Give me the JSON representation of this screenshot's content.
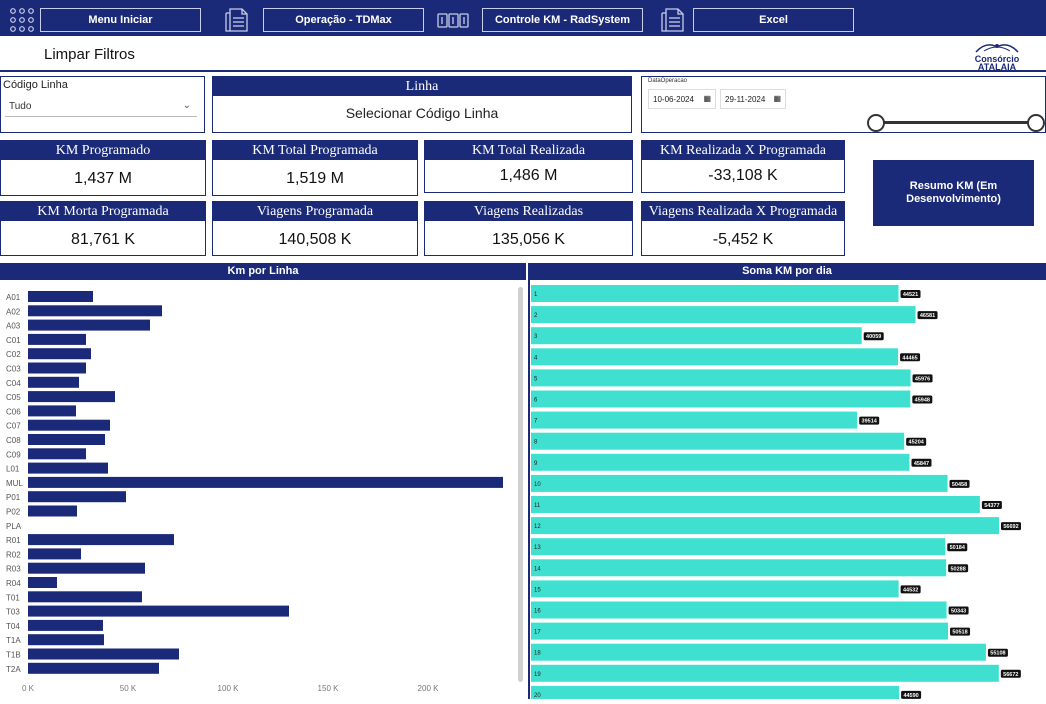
{
  "nav": {
    "menu_label": "Menu Iniciar",
    "operacao_label": "Operação - TDMax",
    "controle_label": "Controle KM - RadSystem",
    "excel_label": "Excel"
  },
  "filter_bar": {
    "limpar_label": "Limpar Filtros",
    "logo_line1": "Consórcio",
    "logo_line2": "ATALAIA"
  },
  "slicer_codigo": {
    "title": "Código Linha",
    "value": "Tudo"
  },
  "slicer_linha": {
    "title": "Linha",
    "value": "Selecionar Código Linha"
  },
  "slicer_data": {
    "title": "DataOperacao",
    "start": "10-06-2024",
    "end": "29-11-2024"
  },
  "kpis": [
    {
      "title": "KM Programado",
      "value": "1,437 M"
    },
    {
      "title": "KM Total Programada",
      "value": "1,519 M"
    },
    {
      "title": "KM Total Realizada",
      "value": "1,486 M"
    },
    {
      "title": "KM Realizada X Programada",
      "value": "-33,108 K"
    },
    {
      "title": "KM Morta Programada",
      "value": "81,761 K"
    },
    {
      "title": "Viagens Programada",
      "value": "140,508 K"
    },
    {
      "title": "Viagens Realizadas",
      "value": "135,056 K"
    },
    {
      "title": "Viagens Realizada X Programada",
      "value": "-5,452 K"
    }
  ],
  "resumo_button": "Resumo KM (Em Desenvolvimento)",
  "colors": {
    "navy": "#1b2a78",
    "bar_navy": "#1b2a78",
    "bar_teal": "#40e0d0"
  },
  "chart_data": [
    {
      "type": "bar",
      "orientation": "horizontal",
      "title": "Km por Linha",
      "categories": [
        "A01",
        "A02",
        "A03",
        "C01",
        "C02",
        "C03",
        "C04",
        "C05",
        "C06",
        "C07",
        "C08",
        "C09",
        "L01",
        "MUL",
        "P01",
        "P02",
        "PLA",
        "R01",
        "R02",
        "R03",
        "R04",
        "T01",
        "T03",
        "T04",
        "T1A",
        "T1B",
        "T2A"
      ],
      "values": [
        32500,
        67000,
        61000,
        29000,
        31500,
        29000,
        25500,
        43500,
        24000,
        41000,
        38500,
        29000,
        40000,
        237500,
        49000,
        24500,
        0,
        73000,
        26500,
        58500,
        14500,
        57000,
        130500,
        37500,
        38000,
        75500,
        65500
      ],
      "xlim": [
        0,
        237500
      ],
      "x_ticks": [
        "0 K",
        "50 K",
        "100 K",
        "150 K",
        "200 K"
      ],
      "x_tick_values": [
        0,
        50000,
        100000,
        150000,
        200000
      ]
    },
    {
      "type": "bar",
      "orientation": "horizontal",
      "title": "Soma KM por dia",
      "categories": [
        "1",
        "2",
        "3",
        "4",
        "5",
        "6",
        "7",
        "8",
        "9",
        "10",
        "11",
        "12",
        "13",
        "14",
        "15",
        "16",
        "17",
        "18",
        "19",
        "20"
      ],
      "values": [
        44521,
        46581,
        40059,
        44465,
        45976,
        45948,
        39514,
        45204,
        45847,
        50458,
        54377,
        56692,
        50184,
        50288,
        44532,
        50343,
        50518,
        55108,
        56672,
        44590
      ],
      "data_labels": [
        "44521",
        "46581",
        "40059",
        "44465",
        "45976",
        "45948",
        "39514",
        "45204",
        "45847",
        "50458",
        "54377",
        "56692",
        "50184",
        "50288",
        "44532",
        "50343",
        "50518",
        "55108",
        "56672",
        "44590"
      ]
    }
  ]
}
